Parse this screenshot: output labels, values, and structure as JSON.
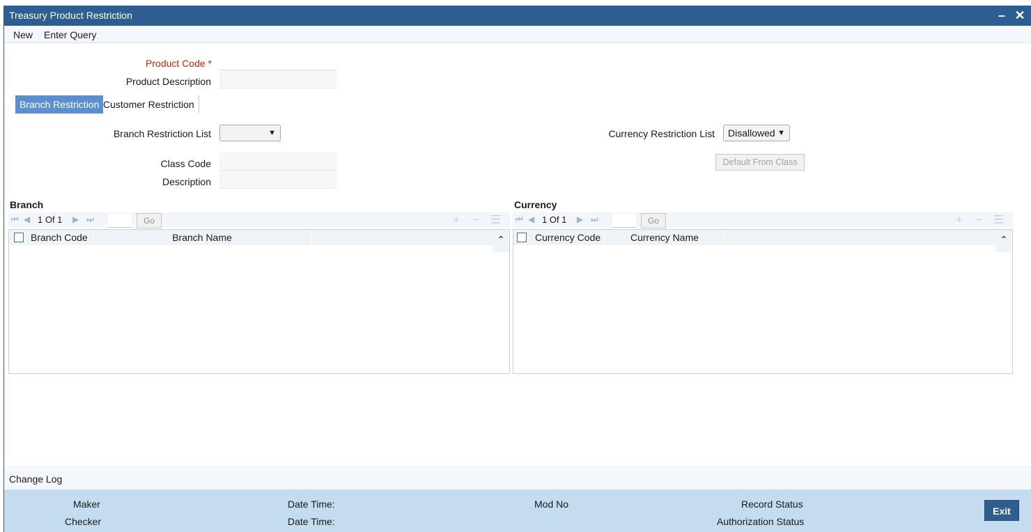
{
  "window": {
    "title": "Treasury Product Restriction",
    "minimize_glyph": "–",
    "close_glyph": "✕"
  },
  "menu": {
    "new": "New",
    "enter_query": "Enter Query"
  },
  "form": {
    "product_code_label": "Product Code",
    "required_marker": "*",
    "product_code_value": "",
    "product_description_label": "Product Description",
    "product_description_value": ""
  },
  "tabs": [
    {
      "label": "Branch Restriction",
      "active": true
    },
    {
      "label": "Customer Restriction",
      "active": false
    }
  ],
  "branch_panel": {
    "restriction_list_label": "Branch Restriction List",
    "restriction_list_value": "",
    "class_code_label": "Class Code",
    "class_code_value": "",
    "description_label": "Description",
    "description_value": ""
  },
  "currency_panel": {
    "restriction_list_label": "Currency Restriction List",
    "restriction_list_value": "Disallowed",
    "default_from_class_label": "Default From Class"
  },
  "branch_grid": {
    "title": "Branch",
    "pager_text": "1 Of 1",
    "go_label": "Go",
    "columns": [
      "Branch Code",
      "Branch Name"
    ],
    "rows": []
  },
  "currency_grid": {
    "title": "Currency",
    "pager_text": "1 Of 1",
    "go_label": "Go",
    "columns": [
      "Currency Code",
      "Currency Name"
    ],
    "rows": []
  },
  "change_log": {
    "label": "Change Log"
  },
  "footer": {
    "maker_label": "Maker",
    "checker_label": "Checker",
    "date_time_label_1": "Date Time:",
    "date_time_label_2": "Date Time:",
    "mod_no_label": "Mod No",
    "record_status_label": "Record Status",
    "authorization_status_label": "Authorization Status",
    "exit_label": "Exit"
  },
  "colors": {
    "titlebar": "#2e5e91",
    "active_tab": "#5b8fcf",
    "footer": "#c5dbef",
    "required": "#d81e05",
    "exit_button": "#2f5d8f"
  }
}
